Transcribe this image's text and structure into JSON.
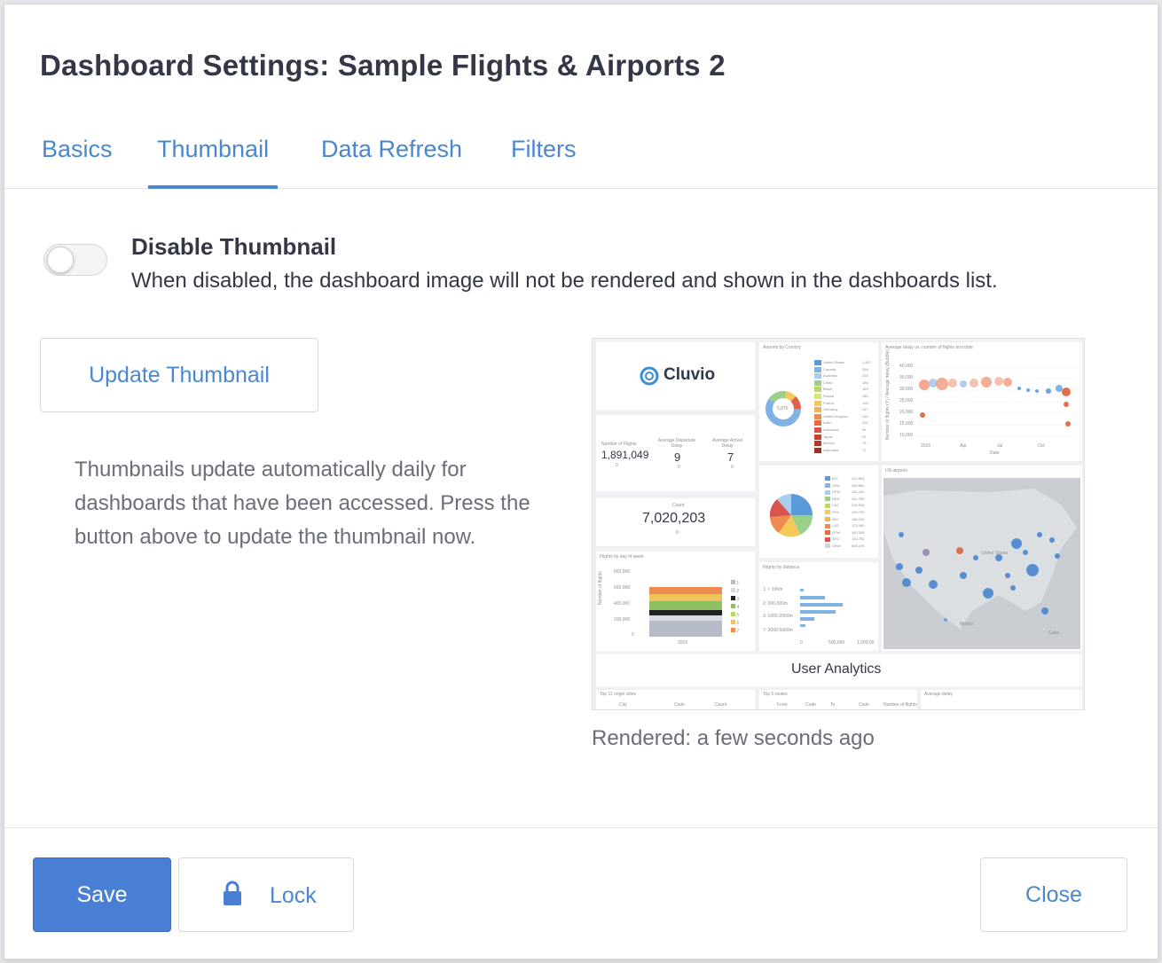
{
  "dialog": {
    "title": "Dashboard Settings: Sample Flights & Airports 2"
  },
  "tabs": [
    {
      "label": "Basics",
      "active": false
    },
    {
      "label": "Thumbnail",
      "active": true
    },
    {
      "label": "Data Refresh",
      "active": false
    },
    {
      "label": "Filters",
      "active": false
    }
  ],
  "disable_thumbnail": {
    "title": "Disable Thumbnail",
    "description": "When disabled, the dashboard image will not be rendered and shown in the dashboards list.",
    "enabled": false
  },
  "update_button": {
    "label": "Update Thumbnail"
  },
  "help_text": "Thumbnails update automatically daily for dashboards that have been accessed. Press the button above to update the thumbnail now.",
  "rendered_text": "Rendered: a few seconds ago",
  "thumbnail": {
    "logo_text": "Cluvio",
    "flights_label": "Number of Flights",
    "flights_value": "1,891,049",
    "dep_delay_label": "Average Departure Delay",
    "dep_delay_value": "9",
    "arr_delay_label": "Average Arrival Delay",
    "arr_delay_value": "7",
    "count_label": "Count",
    "count_value": "7,020,203",
    "delta_value": "0",
    "airports_title": "Airports by Country",
    "donut_center": "5,875",
    "delay_chart_title": "Average delay vs. number of flights and date",
    "us_airports_title": "US airports",
    "dow_title": "Flights by day of week",
    "distance_title": "Flights by distance",
    "user_analytics": "User Analytics",
    "top_cities_title": "Top 11 origin cities",
    "top_routes_title": "Top 5 routes",
    "avg_delay_title": "Average delay",
    "countries": [
      "United States",
      "Canada",
      "Australia",
      "China",
      "Brazil",
      "Russia",
      "France",
      "Germany",
      "United Kingdom",
      "India",
      "Indonesia",
      "Japan",
      "Mexico",
      "Argentina"
    ],
    "country_counts": [
      "1,457",
      "368",
      "215",
      "185",
      "169",
      "146",
      "128",
      "127",
      "120",
      "101",
      "94",
      "91",
      "75",
      "71"
    ],
    "airport_codes": [
      "ATL",
      "ORD",
      "DFW",
      "DEN",
      "LAX",
      "PHX",
      "IAH",
      "LAS",
      "DTW",
      "SFO",
      "Other"
    ],
    "airport_counts": [
      "415,564",
      "350,889",
      "281,442",
      "241,765",
      "215,916",
      "199,739",
      "185,419",
      "175,080",
      "162,208",
      "140,781",
      "665,476"
    ],
    "dow_yticks": [
      "800,000",
      "600,000",
      "400,000",
      "200,000",
      "0"
    ],
    "dow_xlabel": "2016",
    "dow_ylabel": "Number of flights",
    "dow_legend": [
      "1",
      "2",
      "3",
      "4",
      "5",
      "6",
      "7"
    ],
    "distance_cats": [
      "1: < 100m",
      "2: 200-500m",
      "3: 1000-2000m",
      "7: 3000-5000m"
    ],
    "distance_ticks": [
      "0",
      "500,000",
      "1,000,00"
    ],
    "delay_yticks": [
      "40,000",
      "35,000",
      "30,000",
      "25,000",
      "20,000",
      "15,000",
      "10,000"
    ],
    "delay_xticks": [
      "2016",
      "Apr",
      "Jul",
      "Oct"
    ],
    "delay_xlabel": "Date",
    "delay_ylabel": "Number of flights (Y) / Average delay (Bubble)",
    "map_labels": [
      "United States",
      "Mexico",
      "Cuba"
    ],
    "cities_cols": [
      "City",
      "Code",
      "Count"
    ],
    "routes_cols": [
      "From",
      "Code",
      "To",
      "Code",
      "Number of flights"
    ]
  },
  "footer": {
    "save_label": "Save",
    "lock_label": "Lock",
    "close_label": "Close"
  },
  "colors": {
    "accent": "#4a87d0",
    "primary_button": "#4a7fd6"
  }
}
